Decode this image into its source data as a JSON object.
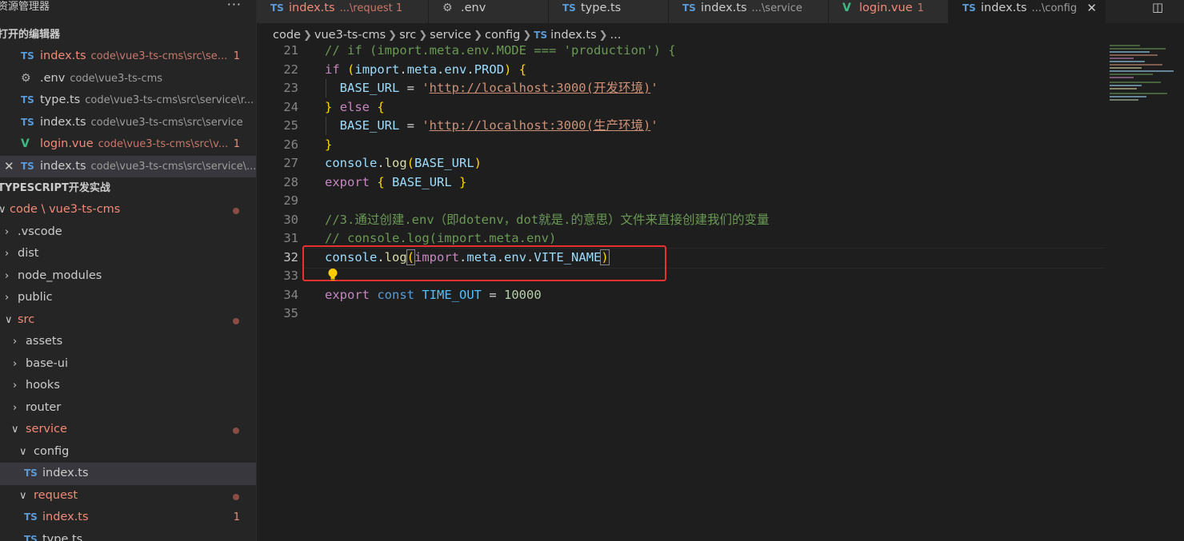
{
  "explorer": {
    "title": "资源管理器",
    "more": "···",
    "open_editors_title": "打开的编辑器",
    "open_editors": [
      {
        "icon": "TS",
        "name": "index.ts",
        "path": "code\\vue3-ts-cms\\src\\se...",
        "badge": "1"
      },
      {
        "icon": "⚙",
        "name": ".env",
        "path": "code\\vue3-ts-cms"
      },
      {
        "icon": "TS",
        "name": "type.ts",
        "path": "code\\vue3-ts-cms\\src\\service\\r..."
      },
      {
        "icon": "TS",
        "name": "index.ts",
        "path": "code\\vue3-ts-cms\\src\\service"
      },
      {
        "icon": "V",
        "name": "login.vue",
        "path": "code\\vue3-ts-cms\\src\\v...",
        "badge": "1"
      },
      {
        "icon": "TS",
        "name": "index.ts",
        "path": "code\\vue3-ts-cms\\src\\service\\...",
        "close": "✕"
      }
    ],
    "project_title": "TYPESCRIPT开发实战",
    "tree": [
      {
        "chev": "∨",
        "label": "code \\ vue3-ts-cms"
      },
      {
        "chev": "›",
        "label": ".vscode"
      },
      {
        "chev": "›",
        "label": "dist"
      },
      {
        "chev": "›",
        "label": "node_modules"
      },
      {
        "chev": "›",
        "label": "public"
      },
      {
        "chev": "∨",
        "label": "src"
      },
      {
        "chev": "›",
        "label": "assets"
      },
      {
        "chev": "›",
        "label": "base-ui"
      },
      {
        "chev": "›",
        "label": "hooks"
      },
      {
        "chev": "›",
        "label": "router"
      },
      {
        "chev": "∨",
        "label": "service"
      },
      {
        "chev": "∨",
        "label": "config"
      },
      {
        "icon": "TS",
        "label": "index.ts"
      },
      {
        "chev": "∨",
        "label": "request"
      },
      {
        "icon": "TS",
        "label": "index.ts",
        "badge": "1"
      },
      {
        "icon": "TS",
        "label": "type.ts"
      }
    ]
  },
  "tabs": [
    {
      "icon": "TS",
      "name": "index.ts",
      "desc": "...\\request 1"
    },
    {
      "icon": "⚙",
      "name": ".env",
      "desc": ""
    },
    {
      "icon": "TS",
      "name": "type.ts",
      "desc": ""
    },
    {
      "icon": "TS",
      "name": "index.ts",
      "desc": "...\\service"
    },
    {
      "icon": "V",
      "name": "login.vue",
      "desc": "1"
    },
    {
      "icon": "TS",
      "name": "index.ts",
      "desc": "...\\config",
      "close": "✕"
    }
  ],
  "split_icon": "◫",
  "breadcrumb": [
    "code",
    "vue3-ts-cms",
    "src",
    "service",
    "config",
    "index.ts",
    "..."
  ],
  "code_lines": [
    {
      "n": "21",
      "text": "// if (import.meta.env.MODE === 'production') {"
    },
    {
      "n": "22",
      "text": "if (import.meta.env.PROD) {"
    },
    {
      "n": "23",
      "text": "  BASE_URL = 'http://localhost:3000(开发环境)'"
    },
    {
      "n": "24",
      "text": "} else {"
    },
    {
      "n": "25",
      "text": "  BASE_URL = 'http://localhost:3000(生产环境)'"
    },
    {
      "n": "26",
      "text": "}"
    },
    {
      "n": "27",
      "text": "console.log(BASE_URL)"
    },
    {
      "n": "28",
      "text": "export { BASE_URL }"
    },
    {
      "n": "29",
      "text": ""
    },
    {
      "n": "30",
      "text": "//3.通过创建.env（即dotenv，dot就是.的意思）文件来直接创建我们的变量"
    },
    {
      "n": "31",
      "text": "// console.log(import.meta.env)"
    },
    {
      "n": "32",
      "text": "console.log(import.meta.env.VITE_NAME)"
    },
    {
      "n": "33",
      "text": ""
    },
    {
      "n": "34",
      "text": "export const TIME_OUT = 10000"
    },
    {
      "n": "35",
      "text": ""
    }
  ],
  "tok": {
    "c21": "// if (import.meta.env.MODE === 'production') {",
    "if": "if",
    "import": "import",
    "meta": "meta",
    "env": "env",
    "PROD": "PROD",
    "BASE_URL": "BASE_URL",
    "url_dev": "http://localhost:3000(开发环境)",
    "url_prod": "http://localhost:3000(生产环境)",
    "else": "else",
    "console": "console",
    "log": "log",
    "export": "export",
    "c30": "//3.通过创建.env（即dotenv，dot就是.的意思）文件来直接创建我们的变量",
    "c31": "// console.log(import.meta.env)",
    "VITE_NAME": "VITE_NAME",
    "const": "const",
    "TIME_OUT": "TIME_OUT",
    "num": "10000"
  }
}
